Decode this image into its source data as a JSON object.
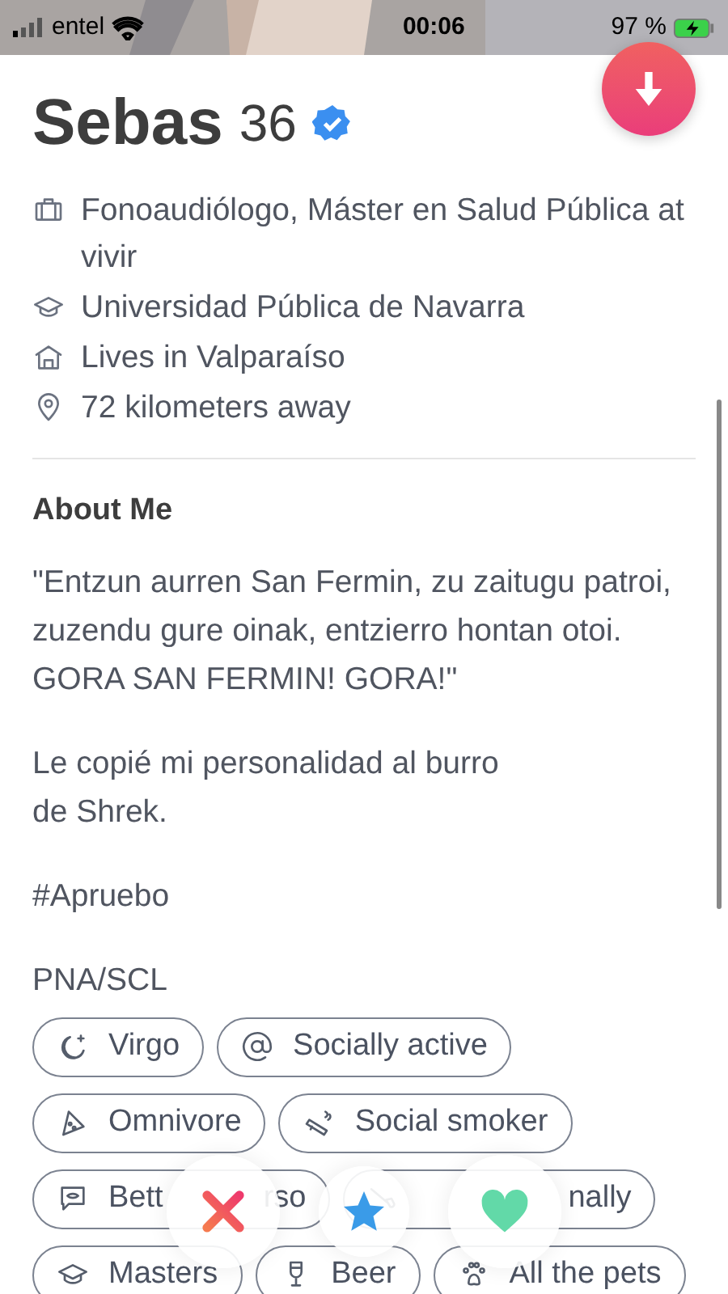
{
  "status_bar": {
    "carrier": "entel",
    "time": "00:06",
    "battery": "97 %"
  },
  "profile": {
    "name": "Sebas",
    "age": "36",
    "verified": true
  },
  "info": [
    {
      "kind": "job",
      "text": "Fonoaudiólogo, Máster en Salud Pública at vivir"
    },
    {
      "kind": "school",
      "text": "Universidad Pública de Navarra"
    },
    {
      "kind": "home",
      "text": "Lives in Valparaíso"
    },
    {
      "kind": "distance",
      "text": "72 kilometers away"
    }
  ],
  "about": {
    "title": "About Me",
    "paragraphs": [
      "\"Entzun aurren San Fermin, zu zaitugu patroi, zuzendu gure oinak, entzierro hontan otoi. GORA SAN FERMIN! GORA!\"",
      "Le copié mi personalidad al burro\nde Shrek.",
      "#Apruebo",
      "PNA/SCL"
    ]
  },
  "chip_rows": [
    [
      {
        "kind": "zodiac",
        "label": "Virgo"
      },
      {
        "kind": "social_media",
        "label": "Socially active"
      }
    ],
    [
      {
        "kind": "diet",
        "label": "Omnivore"
      },
      {
        "kind": "smoking",
        "label": "Social smoker"
      }
    ],
    [
      {
        "kind": "communication",
        "label": "Bett",
        "label_end": "rso"
      },
      {
        "kind": "drugs",
        "label_end": "nally"
      }
    ],
    [
      {
        "kind": "education",
        "label": "Masters"
      },
      {
        "kind": "drinking",
        "label": "Beer"
      },
      {
        "kind": "pets",
        "label": "All the pets"
      }
    ]
  ],
  "actions": [
    {
      "kind": "nope"
    },
    {
      "kind": "super_like"
    },
    {
      "kind": "like"
    }
  ]
}
